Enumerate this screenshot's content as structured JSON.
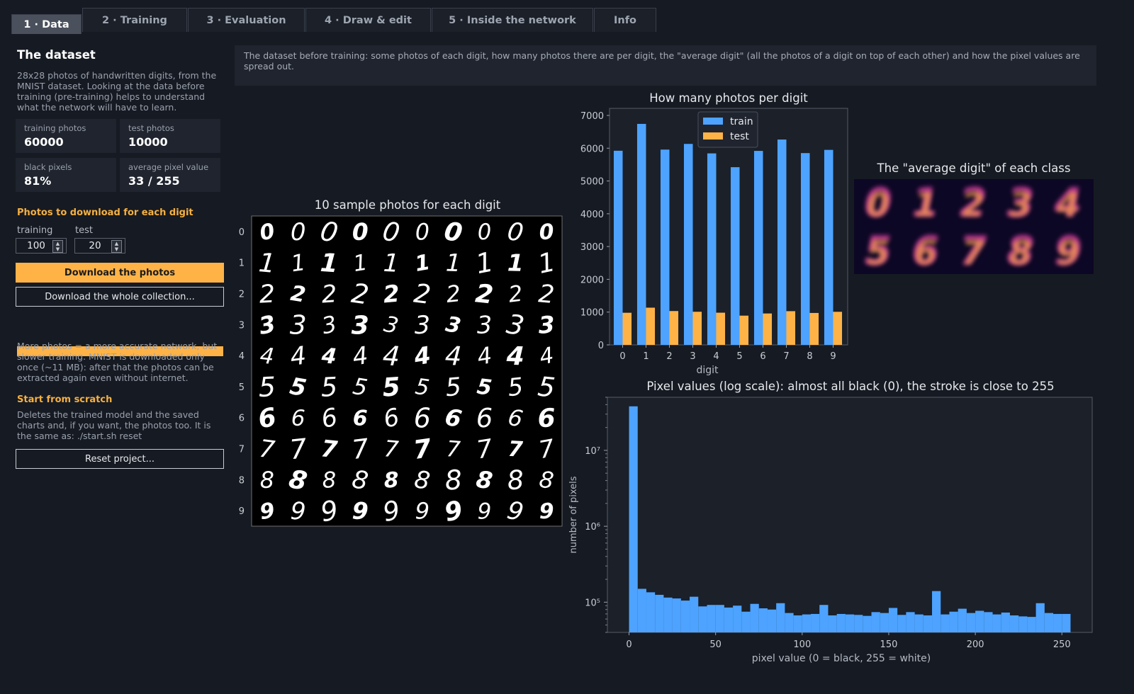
{
  "tabs": [
    {
      "label": "1 · Data",
      "active": true
    },
    {
      "label": "2 · Training",
      "active": false
    },
    {
      "label": "3 · Evaluation",
      "active": false
    },
    {
      "label": "4 · Draw & edit",
      "active": false
    },
    {
      "label": "5 · Inside the network",
      "active": false
    },
    {
      "label": "Info",
      "active": false
    }
  ],
  "sidebar": {
    "title": "The dataset",
    "intro": "28x28 photos of handwritten digits, from the\nMNIST dataset. Looking at the data before\ntraining (pre-training) helps to understand\nwhat the network will have to learn.",
    "stats": [
      {
        "label": "training photos",
        "value": "60000"
      },
      {
        "label": "test photos",
        "value": "10000"
      },
      {
        "label": "black pixels",
        "value": "81%"
      },
      {
        "label": "average pixel value",
        "value": "33 / 255"
      }
    ],
    "download_heading": "Photos to download for each digit",
    "training_label": "training",
    "training_value": "100",
    "test_label": "test",
    "test_value": "20",
    "download_button": "Download the photos",
    "download_all_button": "Download the whole collection...",
    "progress_fraction": 1.0,
    "more_text": "More photos = a more accurate network, but\nslower training. MNIST is downloaded only\nonce (~11 MB): after that the photos can be\nextracted again even without internet.",
    "scratch_heading": "Start from scratch",
    "scratch_text": "Deletes the trained model and the saved\ncharts and, if you want, the photos too. It is\nthe same as:  ./start.sh reset",
    "reset_button": "Reset project..."
  },
  "banner": {
    "text": "The dataset before training: some photos of each digit, how many photos there are per digit, the \"average digit\" (all the photos of a digit on top of each other) and how the pixel values are spread out."
  },
  "colors": {
    "train": "#4da3ff",
    "test": "#ffb347",
    "accent": "#ffb347"
  },
  "samples": {
    "title": "10 sample photos for each digit",
    "row_labels": [
      "0",
      "1",
      "2",
      "3",
      "4",
      "5",
      "6",
      "7",
      "8",
      "9"
    ],
    "per_row": 10
  },
  "averages": {
    "title": "The \"average digit\" of each class",
    "digits": [
      "0",
      "1",
      "2",
      "3",
      "4",
      "5",
      "6",
      "7",
      "8",
      "9"
    ]
  },
  "chart_data": [
    {
      "type": "bar",
      "title": "How many photos per digit",
      "xlabel": "digit",
      "ylabel": "",
      "categories": [
        "0",
        "1",
        "2",
        "3",
        "4",
        "5",
        "6",
        "7",
        "8",
        "9"
      ],
      "series": [
        {
          "name": "train",
          "values": [
            5923,
            6742,
            5958,
            6131,
            5842,
            5421,
            5918,
            6265,
            5851,
            5949
          ]
        },
        {
          "name": "test",
          "values": [
            980,
            1135,
            1032,
            1010,
            982,
            892,
            958,
            1028,
            974,
            1009
          ]
        }
      ],
      "ylim": [
        0,
        7000
      ],
      "yticks": [
        0,
        1000,
        2000,
        3000,
        4000,
        5000,
        6000,
        7000
      ],
      "legend": "top-center"
    },
    {
      "type": "bar",
      "title": "Pixel values (log scale): almost all black (0), the stroke is close to 255",
      "xlabel": "pixel value (0 = black, 255 = white)",
      "ylabel": "number of pixels",
      "yscale": "log",
      "bin_width": 5,
      "x_bin_starts": [
        0,
        5,
        10,
        15,
        20,
        25,
        30,
        35,
        40,
        45,
        50,
        55,
        60,
        65,
        70,
        75,
        80,
        85,
        90,
        95,
        100,
        105,
        110,
        115,
        120,
        125,
        130,
        135,
        140,
        145,
        150,
        155,
        160,
        165,
        170,
        175,
        180,
        185,
        190,
        195,
        200,
        205,
        210,
        215,
        220,
        225,
        230,
        235,
        240,
        245,
        250
      ],
      "values": [
        38000000,
        150000,
        135000,
        125000,
        115000,
        112000,
        105000,
        118000,
        88000,
        92000,
        92000,
        85000,
        90000,
        75000,
        95000,
        83000,
        80000,
        97000,
        72000,
        67000,
        69000,
        70000,
        92000,
        67000,
        70000,
        69000,
        68000,
        66000,
        74000,
        72000,
        84000,
        68000,
        74000,
        69000,
        67000,
        140000,
        69000,
        75000,
        82000,
        72000,
        77000,
        74000,
        69000,
        73000,
        67000,
        65000,
        64000,
        97000,
        72000,
        70000,
        70000
      ],
      "xticks": [
        0,
        50,
        100,
        150,
        200,
        250
      ],
      "ytick_labels": [
        "10⁵",
        "10⁶",
        "10⁷"
      ],
      "ylim": [
        40000,
        50000000
      ]
    }
  ]
}
